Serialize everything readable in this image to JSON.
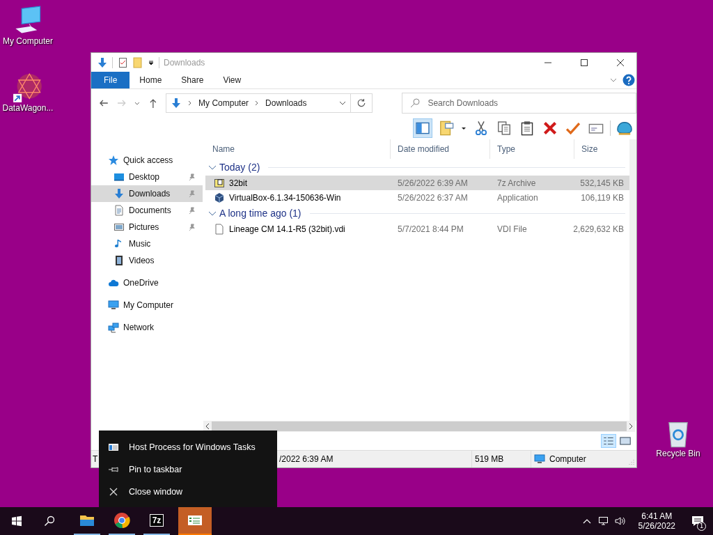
{
  "desktop_icons": [
    {
      "label": "My Computer",
      "kind": "computer"
    },
    {
      "label": "DataWagon...",
      "kind": "shortcut"
    },
    {
      "label": "Recycle Bin",
      "kind": "recycle"
    }
  ],
  "window": {
    "title": "Downloads",
    "ribbon_tabs": [
      {
        "label": "File",
        "kind": "file"
      },
      {
        "label": "Home",
        "kind": "tab"
      },
      {
        "label": "Share",
        "kind": "tab"
      },
      {
        "label": "View",
        "kind": "tab"
      }
    ],
    "address": {
      "path": [
        "My Computer",
        "Downloads"
      ]
    },
    "search": {
      "placeholder": "Search Downloads"
    },
    "nav_pane": [
      {
        "label": "Quick access",
        "kind": "star",
        "children": [
          {
            "label": "Desktop",
            "kind": "desktop",
            "pinned": true,
            "selected": false
          },
          {
            "label": "Downloads",
            "kind": "download",
            "pinned": true,
            "selected": true
          },
          {
            "label": "Documents",
            "kind": "document",
            "pinned": true,
            "selected": false
          },
          {
            "label": "Pictures",
            "kind": "pictures",
            "pinned": true,
            "selected": false
          },
          {
            "label": "Music",
            "kind": "music",
            "pinned": false,
            "selected": false
          },
          {
            "label": "Videos",
            "kind": "videos",
            "pinned": false,
            "selected": false
          }
        ]
      },
      {
        "label": "OneDrive",
        "kind": "cloud"
      },
      {
        "label": "My Computer",
        "kind": "computer"
      },
      {
        "label": "Network",
        "kind": "network"
      }
    ],
    "columns": [
      "Name",
      "Date modified",
      "Type",
      "Size"
    ],
    "groups": [
      {
        "label": "Today (2)",
        "expanded": true,
        "rows": [
          {
            "name": "32bit",
            "kind": "archive",
            "date": "5/26/2022 6:39 AM",
            "type": "7z Archive",
            "size": "532,145 KB",
            "selected": true
          },
          {
            "name": "VirtualBox-6.1.34-150636-Win",
            "kind": "cube",
            "date": "5/26/2022 6:37 AM",
            "type": "Application",
            "size": "106,119 KB",
            "selected": false
          }
        ]
      },
      {
        "label": "A long time ago (1)",
        "expanded": true,
        "rows": [
          {
            "name": "Lineage CM 14.1-R5 (32bit).vdi",
            "kind": "file",
            "date": "5/7/2021 8:44 PM",
            "type": "VDI File",
            "size": "2,629,632 KB",
            "selected": false
          }
        ]
      }
    ],
    "status_bar": [
      "T",
      "/2022 6:39 AM",
      "519 MB",
      "Computer"
    ]
  },
  "context_menu": [
    {
      "label": "Host Process for Windows Tasks",
      "kind": "app"
    },
    {
      "label": "Pin to taskbar",
      "kind": "pin"
    },
    {
      "label": "Close window",
      "kind": "close"
    }
  ],
  "taskbar": {
    "apps": [
      {
        "kind": "explorer",
        "running": true,
        "selected": false
      },
      {
        "kind": "chrome",
        "running": true,
        "selected": false
      },
      {
        "kind": "sevenzip",
        "glyph": "7z",
        "running": true,
        "selected": false
      },
      {
        "kind": "tasks",
        "running": false,
        "selected": true
      }
    ],
    "time": "6:41 AM",
    "date": "5/26/2022",
    "notifications": "1"
  }
}
